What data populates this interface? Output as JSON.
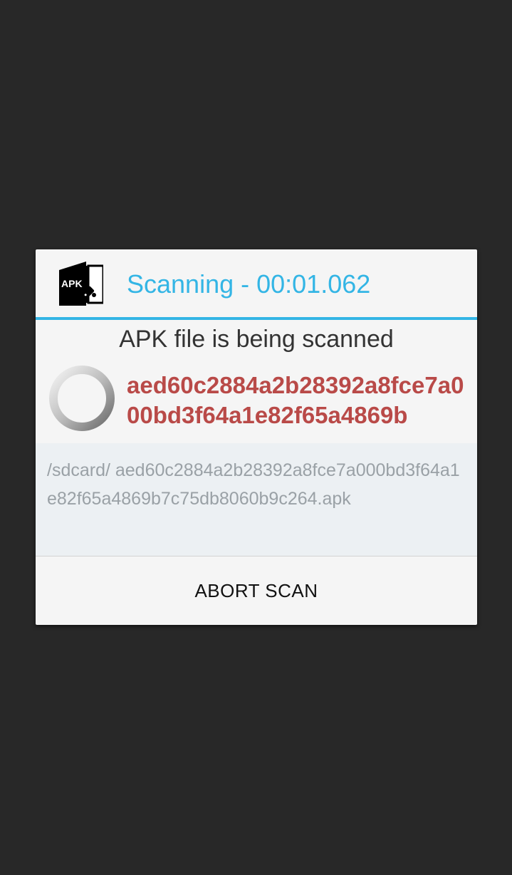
{
  "dialog": {
    "icon": "apk-icon",
    "icon_text": "APK",
    "title": "Scanning - 00:01.062",
    "message": "APK file is being scanned",
    "spinner_icon": "loading-spinner-icon",
    "file_hash": "aed60c2884a2b28392a8fce7a000bd3f64a1e82f65a4869b",
    "file_path": "/sdcard/ aed60c2884a2b28392a8fce7a000bd3f64a1e82f65a4869b7c75db8060b9c264.apk",
    "abort_button_label": "ABORT SCAN"
  },
  "colors": {
    "background": "#282828",
    "dialog": "#f5f5f5",
    "accent": "#33b5e5",
    "hash": "#b94a48",
    "path_box": "#ecf0f3"
  }
}
